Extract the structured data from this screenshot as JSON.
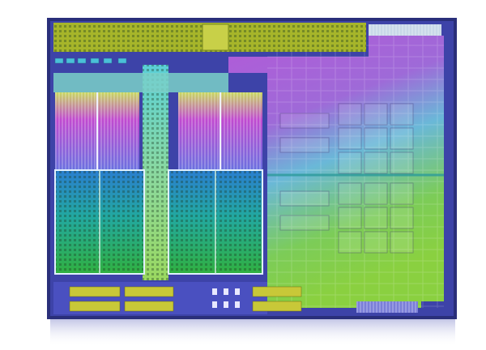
{
  "image": {
    "subject": "processor-die-shot",
    "caption": "",
    "colors": {
      "background": "#ffffff",
      "frame": "#2a2f7a",
      "bezel": "#3a3f9a",
      "top_io_bar": "#a6b52a",
      "cpu_cache_top": "#c04ad0",
      "cpu_cache_bottom": "#3ea0d8",
      "cpu_core_top": "#2a86d0",
      "cpu_core_bottom": "#2fb050",
      "gpu_top": "#b25ad8",
      "gpu_mid": "#5ab8d8",
      "gpu_bottom": "#8ad040",
      "spine": "#7cd0a8",
      "bottom_io": "#c8c838"
    }
  }
}
